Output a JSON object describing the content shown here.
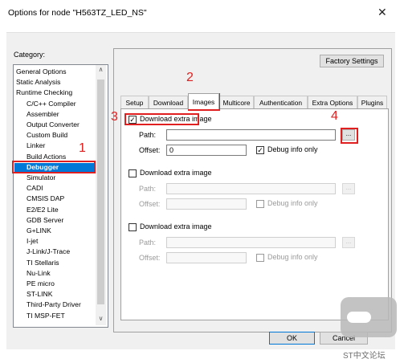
{
  "window": {
    "title": "Options for node \"H563TZ_LED_NS\"",
    "close": "✕"
  },
  "category": {
    "label": "Category:",
    "items": [
      {
        "label": "General Options",
        "indent": false,
        "selected": false
      },
      {
        "label": "Static Analysis",
        "indent": false,
        "selected": false
      },
      {
        "label": "Runtime Checking",
        "indent": false,
        "selected": false
      },
      {
        "label": "C/C++ Compiler",
        "indent": true,
        "selected": false
      },
      {
        "label": "Assembler",
        "indent": true,
        "selected": false
      },
      {
        "label": "Output Converter",
        "indent": true,
        "selected": false
      },
      {
        "label": "Custom Build",
        "indent": true,
        "selected": false
      },
      {
        "label": "Linker",
        "indent": true,
        "selected": false
      },
      {
        "label": "Build Actions",
        "indent": true,
        "selected": false
      },
      {
        "label": "Debugger",
        "indent": true,
        "selected": true
      },
      {
        "label": "Simulator",
        "indent": true,
        "selected": false
      },
      {
        "label": "CADI",
        "indent": true,
        "selected": false
      },
      {
        "label": "CMSIS DAP",
        "indent": true,
        "selected": false
      },
      {
        "label": "E2/E2 Lite",
        "indent": true,
        "selected": false
      },
      {
        "label": "GDB Server",
        "indent": true,
        "selected": false
      },
      {
        "label": "G+LINK",
        "indent": true,
        "selected": false
      },
      {
        "label": "I-jet",
        "indent": true,
        "selected": false
      },
      {
        "label": "J-Link/J-Trace",
        "indent": true,
        "selected": false
      },
      {
        "label": "TI Stellaris",
        "indent": true,
        "selected": false
      },
      {
        "label": "Nu-Link",
        "indent": true,
        "selected": false
      },
      {
        "label": "PE micro",
        "indent": true,
        "selected": false
      },
      {
        "label": "ST-LINK",
        "indent": true,
        "selected": false
      },
      {
        "label": "Third-Party Driver",
        "indent": true,
        "selected": false
      },
      {
        "label": "TI MSP-FET",
        "indent": true,
        "selected": false
      }
    ]
  },
  "factory_button": "Factory Settings",
  "tabs": [
    "Setup",
    "Download",
    "Images",
    "Multicore",
    "Authentication",
    "Extra Options",
    "Plugins"
  ],
  "active_tab": "Images",
  "images": [
    {
      "checkbox_label": "Download extra image",
      "checked": true,
      "enabled": true,
      "path_label": "Path:",
      "path_value": "",
      "offset_label": "Offset:",
      "offset_value": "0",
      "debug_label": "Debug info only",
      "debug_checked": true,
      "browse": "..."
    },
    {
      "checkbox_label": "Download extra image",
      "checked": false,
      "enabled": false,
      "path_label": "Path:",
      "path_value": "",
      "offset_label": "Offset:",
      "offset_value": "",
      "debug_label": "Debug info only",
      "debug_checked": false,
      "browse": "..."
    },
    {
      "checkbox_label": "Download extra image",
      "checked": false,
      "enabled": false,
      "path_label": "Path:",
      "path_value": "",
      "offset_label": "Offset:",
      "offset_value": "",
      "debug_label": "Debug info only",
      "debug_checked": false,
      "browse": "..."
    }
  ],
  "footer": {
    "ok": "OK",
    "cancel": "Cancel"
  },
  "annotations": [
    "1",
    "2",
    "3",
    "4"
  ],
  "watermark": "ST中文论坛",
  "colors": {
    "highlight": "#e02020",
    "selection": "#0078d7"
  }
}
